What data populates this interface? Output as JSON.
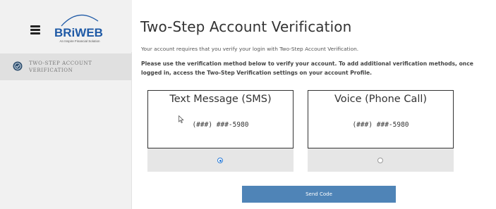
{
  "sidebar": {
    "logo_text": "BRiWEB",
    "logo_tagline": "An Inspire Financial Solution",
    "menu_icon": "hamburger-menu-icon",
    "nav_items": [
      {
        "label": "TWO-STEP ACCOUNT VERIFICATION",
        "icon": "verification-badge-icon"
      }
    ]
  },
  "main": {
    "title": "Two-Step Account Verification",
    "intro": "Your account requires that you verify your login with Two-Step Account Verification.",
    "instructions": "Please use the verification method below to verify your account. To add additional verification methods, once logged in, access the Two-Step Verification settings on your account Profile.",
    "methods": [
      {
        "title": "Text Message (SMS)",
        "number": "(###) ###-5980",
        "selected": true
      },
      {
        "title": "Voice (Phone Call)",
        "number": "(###) ###-5980",
        "selected": false
      }
    ],
    "send_label": "Send Code"
  },
  "colors": {
    "button": "#4f84b7",
    "radio_selected": "#2a7bd6",
    "logo_blue": "#1f5aa6"
  }
}
